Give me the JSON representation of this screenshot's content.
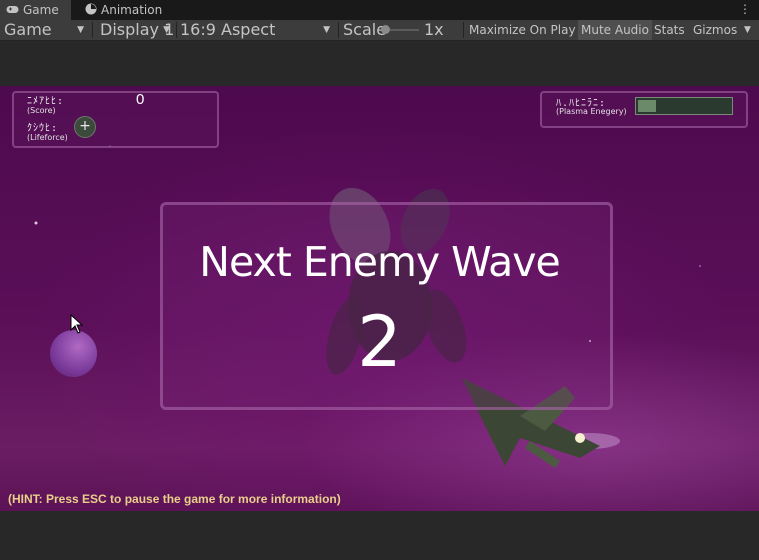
{
  "tabs": {
    "game_label": "Game",
    "animation_label": "Animation"
  },
  "toolbar": {
    "view_mode": "Game",
    "display": "Display 1",
    "aspect": "16:9 Aspect",
    "scale_label": "Scale",
    "scale_value": "1x",
    "maximize_label": "Maximize On Play",
    "mute_label": "Mute Audio",
    "stats_label": "Stats",
    "gizmos_label": "Gizmos"
  },
  "hud": {
    "score_alien": "ﾆﾒｱﾋﾋ:",
    "score_sub": "(Score)",
    "score_value": "0",
    "life_alien": "ｸｼｳﾋ:",
    "life_sub": "(Lifeforce)",
    "life_button": "+",
    "plasma_alien": "ﾊ.ﾊﾋﾆﾗﾆ:",
    "plasma_sub": "(Plasma Enegery)",
    "plasma_level": 0.2
  },
  "wave": {
    "title": "Next Enemy Wave",
    "number": "2"
  },
  "hint": "(HINT: Press ESC to pause the game for more information)",
  "colors": {
    "editor_bg": "#282828",
    "toolbar_bg": "#3c3c3c",
    "space_purple": "#5a0f57",
    "hint_yellow": "#e8d08a"
  }
}
